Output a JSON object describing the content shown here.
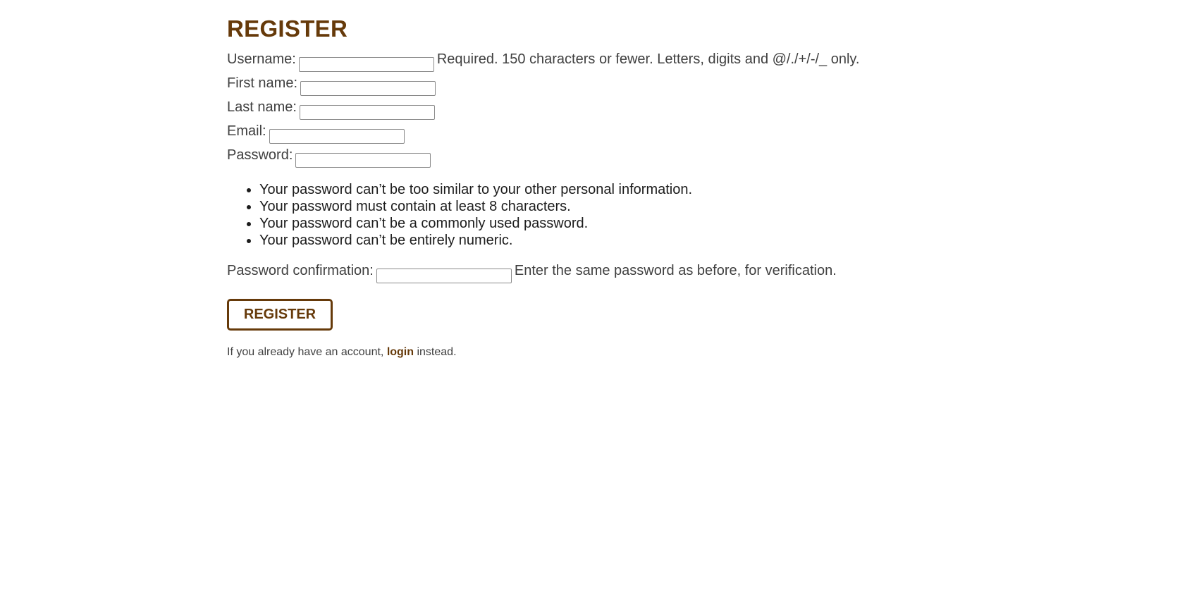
{
  "page": {
    "title": "REGISTER"
  },
  "form": {
    "username": {
      "label": "Username:",
      "value": "",
      "help": "Required. 150 characters or fewer. Letters, digits and @/./+/-/_ only."
    },
    "first_name": {
      "label": "First name:",
      "value": ""
    },
    "last_name": {
      "label": "Last name:",
      "value": ""
    },
    "email": {
      "label": "Email:",
      "value": ""
    },
    "password": {
      "label": "Password:",
      "value": "",
      "rules": [
        "Your password can’t be too similar to your other personal information.",
        "Your password must contain at least 8 characters.",
        "Your password can’t be a commonly used password.",
        "Your password can’t be entirely numeric."
      ]
    },
    "password_confirmation": {
      "label": "Password confirmation:",
      "value": "",
      "help": "Enter the same password as before, for verification."
    },
    "submit_label": "REGISTER"
  },
  "footer": {
    "prefix": "If you already have an account, ",
    "link_label": "login",
    "suffix": " instead."
  },
  "colors": {
    "accent": "#663a0a",
    "text": "#404040"
  }
}
